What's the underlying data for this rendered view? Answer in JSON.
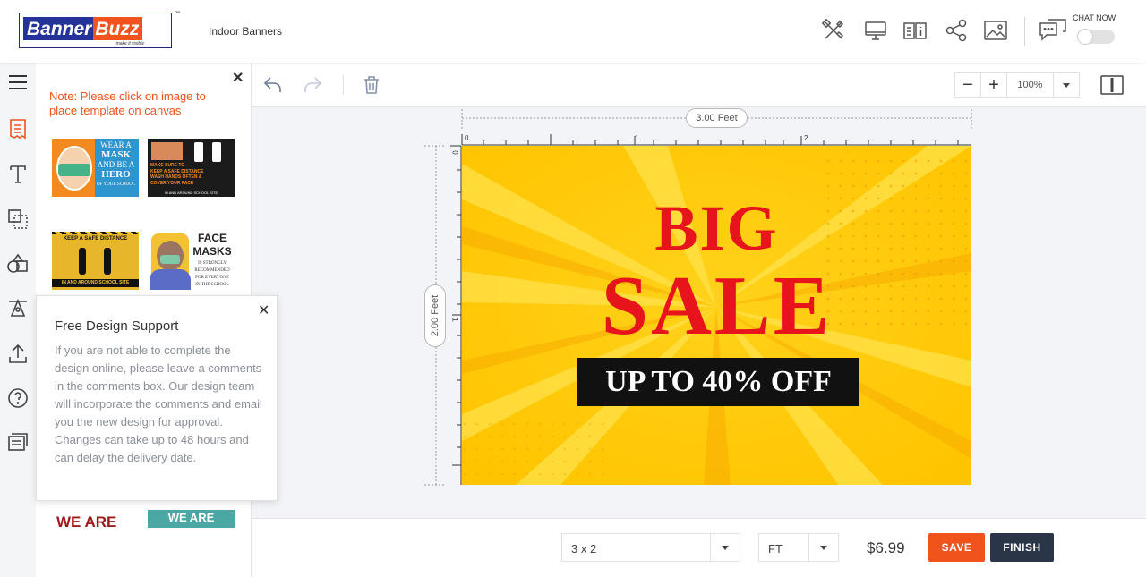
{
  "header": {
    "logo_part1": "Banner",
    "logo_part2": "Buzz",
    "logo_tagline": "make it visible",
    "logo_tm": "™",
    "product_title": "Indoor Banners",
    "chat_label": "CHAT NOW",
    "icons": [
      "tools-icon",
      "monitor-icon",
      "book-info-icon",
      "share-icon",
      "image-icon",
      "chat-icon"
    ]
  },
  "sidebar": {
    "rail_icons": [
      "menu-icon",
      "template-icon",
      "text-icon",
      "layers-icon",
      "shapes-icon",
      "clipart-icon",
      "upload-icon",
      "help-icon",
      "comments-icon"
    ],
    "note": "Note: Please click on image to place template on canvas",
    "templates": [
      {
        "lines": [
          "WEAR A",
          "MASK",
          "AND BE A",
          "HERO",
          "OF YOUR SCHOOL"
        ]
      },
      {
        "lines": [
          "MAKE SURE TO",
          "KEEP A SAFE DISTANCE",
          "WASH HANDS OFTEN &",
          "COVER YOUR FACE",
          "IN AND AROUND SCHOOL SITE"
        ]
      },
      {
        "lines": [
          "KEEP A SAFE DISTANCE",
          "IN AND AROUND SCHOOL SITE"
        ]
      },
      {
        "lines": [
          "FACE",
          "MASKS",
          "IS STRONGLY",
          "RECOMMENDED",
          "FOR EVERYONE",
          "IN THE SCHOOL"
        ]
      },
      {
        "lines": [
          "WE ARE"
        ]
      },
      {
        "lines": [
          "WE ARE"
        ]
      }
    ]
  },
  "popup": {
    "title": "Free Design Support",
    "body": "If you are not able to complete the design online, please leave a comments in the comments box. Our design team will incorporate the comments and email you the new design for approval. Changes can take up to 48 hours and can delay the delivery date."
  },
  "toolbar": {
    "zoom_value": "100%"
  },
  "canvas": {
    "width_label": "3.00 Feet",
    "height_label": "2.00 Feet",
    "ruler_h": [
      "0",
      "1",
      "2"
    ],
    "ruler_v": [
      "0",
      "1"
    ],
    "headline1": "BIG",
    "headline2": "SALE",
    "subline": "UP TO 40% OFF",
    "colors": {
      "background": "#ffcc00",
      "headline": "#e8141c",
      "band": "#111111"
    }
  },
  "footer": {
    "size_value": "3 x 2",
    "unit_value": "FT",
    "price": "$6.99",
    "save_label": "SAVE",
    "finish_label": "FINISH",
    "save_color": "#f0531c",
    "finish_color": "#2a3547"
  }
}
